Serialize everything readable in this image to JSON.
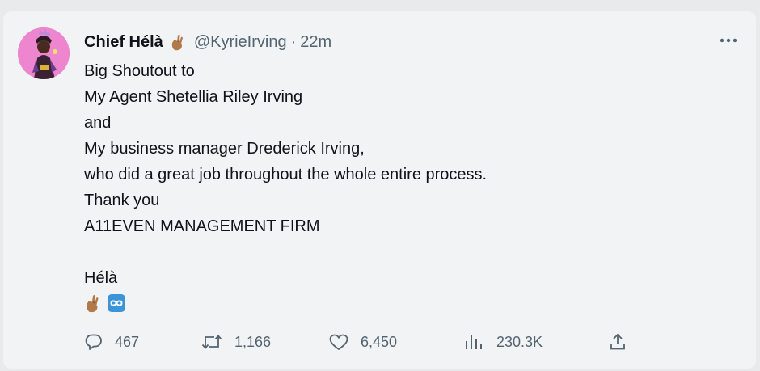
{
  "tweet": {
    "author_name": "Chief Hélà",
    "handle": "@KyrieIrving",
    "separator": "·",
    "time": "22m",
    "lines": [
      "Big Shoutout to",
      "My Agent Shetellia Riley Irving",
      "and",
      "My business manager Drederick Irving,",
      "who did a great job throughout the whole entire process.",
      "Thank you",
      "A11EVEN MANAGEMENT FIRM",
      "",
      "Hélà"
    ],
    "emojis": [
      "crossed-fingers-emoji",
      "infinity-emoji"
    ]
  },
  "actions": {
    "replies": "467",
    "retweets": "1,166",
    "likes": "6,450",
    "views": "230.3K"
  },
  "icons": {
    "more": "more-horizontal-icon",
    "reply": "reply-bubble-icon",
    "retweet": "retweet-icon",
    "like": "heart-icon",
    "views": "views-bar-chart-icon",
    "share": "share-upload-icon"
  },
  "colors": {
    "background": "#e9eaec",
    "card": "#f2f3f5",
    "text": "#0f1419",
    "secondary": "#536471",
    "infinity_emoji": "#3b94d9"
  }
}
